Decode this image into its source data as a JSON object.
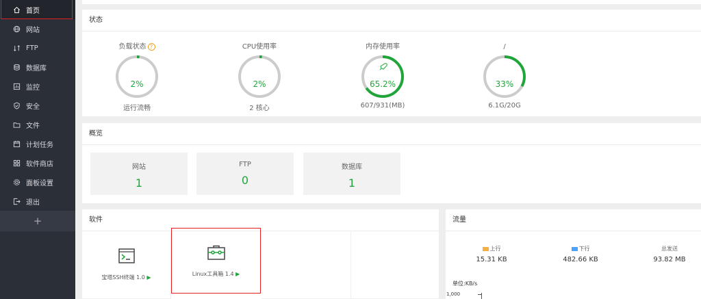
{
  "sidebar": {
    "items": [
      {
        "label": "首页",
        "icon": "home-icon"
      },
      {
        "label": "网站",
        "icon": "globe-icon"
      },
      {
        "label": "FTP",
        "icon": "ftp-icon"
      },
      {
        "label": "数据库",
        "icon": "database-icon"
      },
      {
        "label": "监控",
        "icon": "monitor-icon"
      },
      {
        "label": "安全",
        "icon": "shield-icon"
      },
      {
        "label": "文件",
        "icon": "folder-icon"
      },
      {
        "label": "计划任务",
        "icon": "calendar-icon"
      },
      {
        "label": "软件商店",
        "icon": "grid-icon"
      },
      {
        "label": "面板设置",
        "icon": "gear-icon"
      },
      {
        "label": "退出",
        "icon": "logout-icon"
      }
    ],
    "add_label": "+"
  },
  "status": {
    "title": "状态",
    "gauges": [
      {
        "label": "负载状态",
        "help": "?",
        "value": "2%",
        "percent": 2,
        "sub": "运行流畅"
      },
      {
        "label": "CPU使用率",
        "value": "2%",
        "percent": 2,
        "sub": "2 核心"
      },
      {
        "label": "内存使用率",
        "value": "65.2%",
        "percent": 65.2,
        "sub": "607/931(MB)"
      },
      {
        "label": "/",
        "value": "33%",
        "percent": 33,
        "sub": "6.1G/20G"
      }
    ]
  },
  "overview": {
    "title": "概览",
    "cards": [
      {
        "name": "网站",
        "count": "1"
      },
      {
        "name": "FTP",
        "count": "0"
      },
      {
        "name": "数据库",
        "count": "1"
      }
    ]
  },
  "software": {
    "title": "软件",
    "items": [
      {
        "name": "宝塔SSH终端 1.0",
        "play": "▶"
      },
      {
        "name": "Linux工具箱 1.4",
        "play": "▶"
      }
    ]
  },
  "traffic": {
    "title": "流量",
    "cols": [
      {
        "legend": "上行",
        "value": "15.31 KB"
      },
      {
        "legend": "下行",
        "value": "482.66 KB"
      },
      {
        "legend": "总发送",
        "value": "93.82 MB"
      }
    ],
    "unit": "单位:KB/s",
    "ytick": "1,000"
  },
  "colors": {
    "accent": "#20a53a",
    "sidebar": "#2b2f38",
    "up": "#f5b041",
    "down": "#4aa3ff",
    "highlight": "#e02020"
  }
}
